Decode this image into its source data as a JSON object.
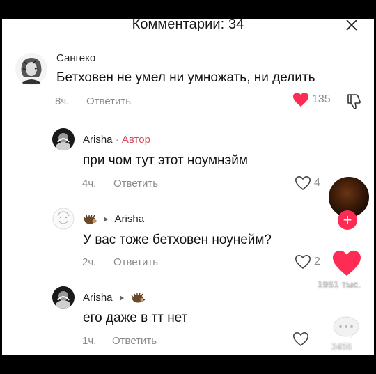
{
  "header": {
    "title": "Комментарии: 34"
  },
  "comments": [
    {
      "name": "Сангеко",
      "text": "Бетховен не умел ни умножать, ни делить",
      "time": "8ч.",
      "reply": "Ответить",
      "likes": "135",
      "liked": true
    },
    {
      "name": "Arisha",
      "badge_sep": "·",
      "badge": "Автор",
      "text": "при чом тут этот ноумнэйм",
      "time": "4ч.",
      "reply": "Ответить",
      "likes": "4"
    },
    {
      "reply_to": "Arisha",
      "text": "У вас тоже бетховен ноунейм?",
      "time": "2ч.",
      "reply": "Ответить",
      "likes": "2"
    },
    {
      "name": "Arisha",
      "text": "его даже в тт нет",
      "time": "1ч.",
      "reply": "Ответить",
      "likes": ""
    }
  ],
  "overlay": {
    "likes_count": "1951 тыс.",
    "comments_count": "3456"
  },
  "colors": {
    "like_red": "#fe2c55",
    "author_red": "#d34b5a",
    "muted": "#8a8a8a"
  }
}
